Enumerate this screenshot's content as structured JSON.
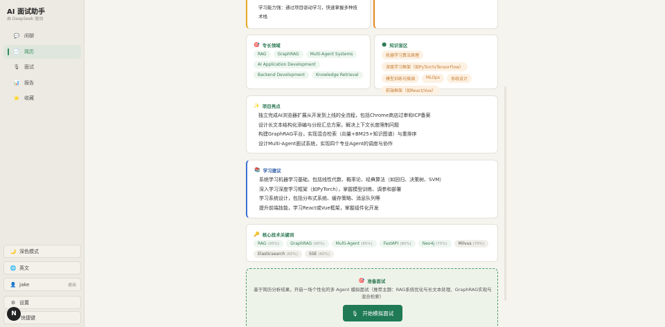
{
  "app": {
    "title": "AI 面试助手",
    "subtitle": "由 DeepSeek 驱动"
  },
  "nav": [
    {
      "label": "闲聊",
      "icon": "chat-icon"
    },
    {
      "label": "简历",
      "icon": "resume-icon",
      "active": true
    },
    {
      "label": "面试",
      "icon": "interview-icon"
    },
    {
      "label": "报告",
      "icon": "report-icon"
    },
    {
      "label": "收藏",
      "icon": "star-icon"
    }
  ],
  "sidebar_bottom": {
    "dark_mode": "深色模式",
    "language": "英文",
    "user": "jake",
    "logout": "退出",
    "settings": "设置",
    "shortcuts": "快捷键",
    "avatar_letter": "N"
  },
  "top_card": {
    "line": "学习能力强：通过项目驱动学习，快速掌握多种技",
    "line2": "术栈"
  },
  "expertise": {
    "title": "专长领域",
    "tags": [
      "RAG",
      "GraphRAG",
      "Multi-Agent Systems",
      "AI Application Development",
      "Backend Development",
      "Knowledge Retrieval"
    ]
  },
  "blind_spots": {
    "title": "知识盲区",
    "tags": [
      "机器学习算法原理",
      "深度学习框架（如PyTorch/TensorFlow）",
      "模型训练与微调",
      "MLOps",
      "系统设计",
      "前端框架（如React/Vue）"
    ]
  },
  "highlights": {
    "title": "项目亮点",
    "items": [
      "独立完成AI浏览器扩展从开发到上线的全流程，包括Chrome商店过审和ICP备案",
      "设计长文本结构化添编与分段汇总方案，解决上下文长度限制问题",
      "构建GraphRAG平台，实现混合检索（向量+BM25+知识图谱）与重排序",
      "设计Multi-Agent面试系统，实现四个专业Agent的调度与协作"
    ]
  },
  "suggestions": {
    "title": "学习建议",
    "items": [
      "系统学习机器学习基础，包括线性代数、概率论、经典算法（如回归、决策树、SVM）",
      "深入学习深度学习框架（如PyTorch），掌握模型训练、调参和部署",
      "学习系统设计，包括分布式系统、缓存策略、消息队列等",
      "提升前端技能，学习React或Vue框架，掌握组件化开发"
    ]
  },
  "keywords": {
    "title": "核心技术关键词",
    "tags": [
      {
        "name": "RAG",
        "pct": "(95%)"
      },
      {
        "name": "GraphRAG",
        "pct": "(90%)"
      },
      {
        "name": "Multi-Agent",
        "pct": "(85%)"
      },
      {
        "name": "FastAPI",
        "pct": "(80%)"
      },
      {
        "name": "Neo4j",
        "pct": "(75%)"
      },
      {
        "name": "Milvus",
        "pct": "(70%)"
      },
      {
        "name": "Elasticsearch",
        "pct": "(65%)"
      },
      {
        "name": "SSE",
        "pct": "(60%)"
      }
    ]
  },
  "prepare": {
    "title": "准备面试",
    "desc": "基于简历分析结果，开启一场个性化的多 Agent 模拟面试（推荐主题：RAG系统优化与长文本处理、GraphRAG实现与混合检索）",
    "button": "开始模拟面试"
  }
}
